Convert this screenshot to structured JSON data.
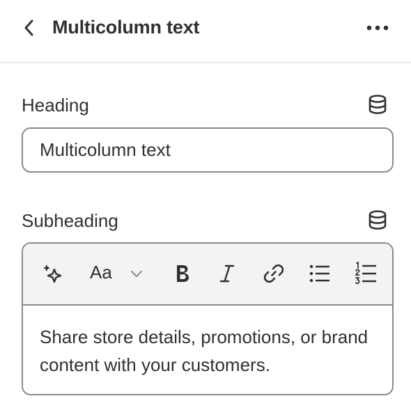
{
  "header": {
    "back_icon": "chevron-left-icon",
    "title": "Multicolumn text",
    "more_icon": "ellipsis-icon"
  },
  "heading_field": {
    "label": "Heading",
    "value": "Multicolumn text",
    "source_icon": "database-icon"
  },
  "subheading_field": {
    "label": "Subheading",
    "source_icon": "database-icon",
    "toolbar": {
      "ai_icon": "sparkle-icon",
      "font_label": "Aa",
      "font_dropdown_icon": "chevron-down-icon",
      "bold_icon": "bold-icon",
      "italic_icon": "italic-icon",
      "link_icon": "link-icon",
      "bullet_list_icon": "bullet-list-icon",
      "numbered_list_icon": "numbered-list-icon"
    },
    "value": "Share store details, promotions, or brand content with your customers."
  },
  "colors": {
    "text": "#303030",
    "border": "#8a8a8a",
    "toolbar_bg": "#f3f3f3",
    "divider": "#ebebeb"
  }
}
